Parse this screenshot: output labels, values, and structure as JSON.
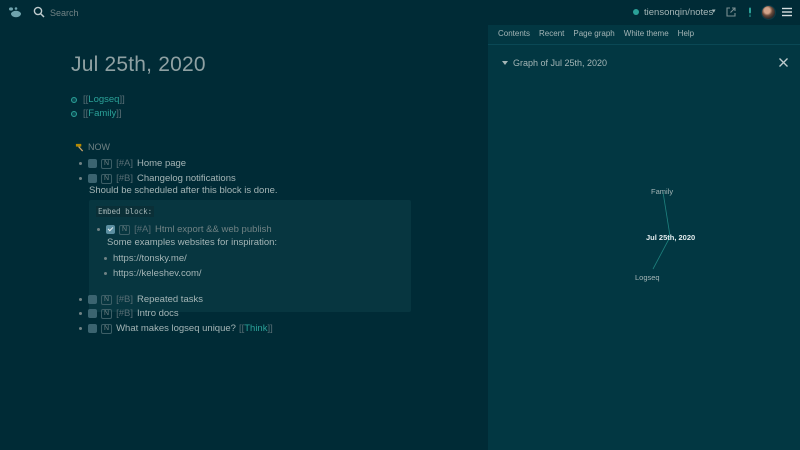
{
  "topbar": {
    "search_placeholder": "Search",
    "repo_name": "tiensonqin/notes",
    "icons": [
      "logseq-logo-icon",
      "search-icon",
      "external-link-icon",
      "microphone-icon",
      "avatar",
      "menu-icon"
    ]
  },
  "page": {
    "title": "Jul 25th, 2020",
    "refs": [
      {
        "open": "[[",
        "label": "Logseq",
        "close": "]]"
      },
      {
        "open": "[[",
        "label": "Family",
        "close": "]]"
      }
    ],
    "now_label": "NOW",
    "tasks": [
      {
        "marker": "N",
        "priority": "[#A]",
        "text": "Home page"
      },
      {
        "marker": "N",
        "priority": "[#B]",
        "text": "Changelog notifications"
      }
    ],
    "changelog_note": "Should be scheduled after this block is done.",
    "embed": {
      "label": "Embed block:",
      "task": {
        "marker": "N",
        "priority": "[#A]",
        "text": "Html export && web publish"
      },
      "note": "Some examples websites for inspiration:",
      "links": [
        "https://tonsky.me/",
        "https://keleshev.com/"
      ]
    },
    "tasks_after": [
      {
        "marker": "N",
        "priority": "[#B]",
        "text": "Repeated tasks"
      },
      {
        "marker": "N",
        "priority": "[#B]",
        "text": "Intro docs"
      }
    ],
    "last_task": {
      "marker": "N",
      "text": "What makes logseq unique?",
      "ref_open": "[[",
      "ref": "Think",
      "ref_close": "]]"
    }
  },
  "sidebar": {
    "nav": [
      "Contents",
      "Recent",
      "Page graph",
      "White theme",
      "Help"
    ],
    "graph_title": "Graph of Jul 25th, 2020",
    "nodes": {
      "center": "Jul 25th, 2020",
      "top": "Family",
      "bottom": "Logseq"
    }
  },
  "colors": {
    "background": "#002b36",
    "sidebar": "#023742",
    "accent": "#2aa198",
    "text": "#a4b5b6"
  }
}
